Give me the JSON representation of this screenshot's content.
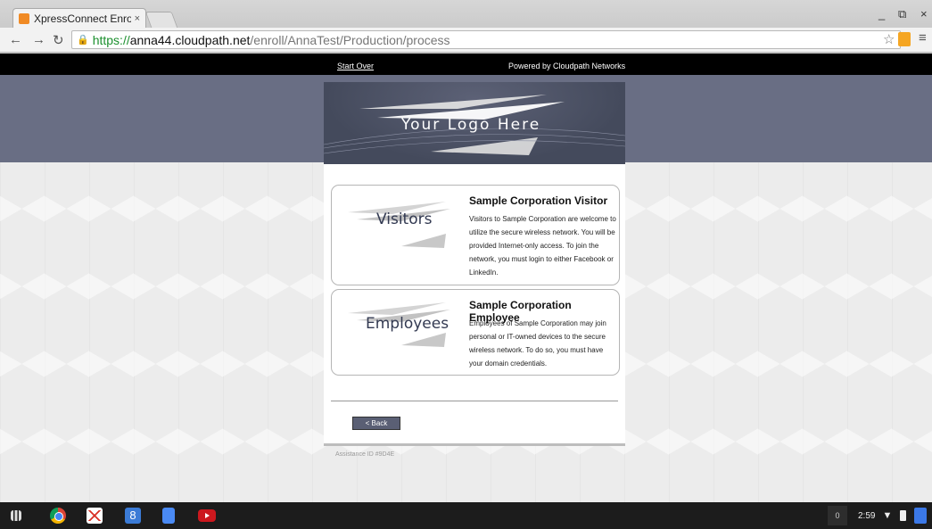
{
  "browser": {
    "tab_title": "XpressConnect Enrollme",
    "tab_close": "×",
    "url_scheme": "https://",
    "url_host": "anna44.cloudpath.net",
    "url_path": "/enroll/AnnaTest/Production/process",
    "minimize": "_",
    "restore": "⧉",
    "close": "×"
  },
  "topbar": {
    "start_over": "Start Over",
    "powered_by": "Powered by Cloudpath Networks"
  },
  "logo": {
    "text": "Your Logo Here"
  },
  "options": [
    {
      "art_label": "Visitors",
      "title": "Sample Corporation Visitor",
      "description": "Visitors to Sample Corporation are welcome to utilize the secure wireless network. You will be provided Internet-only access. To join the network, you must login to either Facebook or LinkedIn."
    },
    {
      "art_label": "Employees",
      "title": "Sample Corporation Employee",
      "description": "Employees of Sample Corporation may join personal or IT-owned devices to the secure wireless network. To do so, you must have your domain credentials."
    }
  ],
  "back_label": "< Back",
  "assistance_id": "Assistance ID #9D4E",
  "taskbar": {
    "notification_count": "0",
    "time": "2:59"
  },
  "colors": {
    "band": "#696e84",
    "logo_bg": "#444a5c",
    "back_button": "#5a5f74",
    "url_scheme": "#1b8f2d"
  }
}
